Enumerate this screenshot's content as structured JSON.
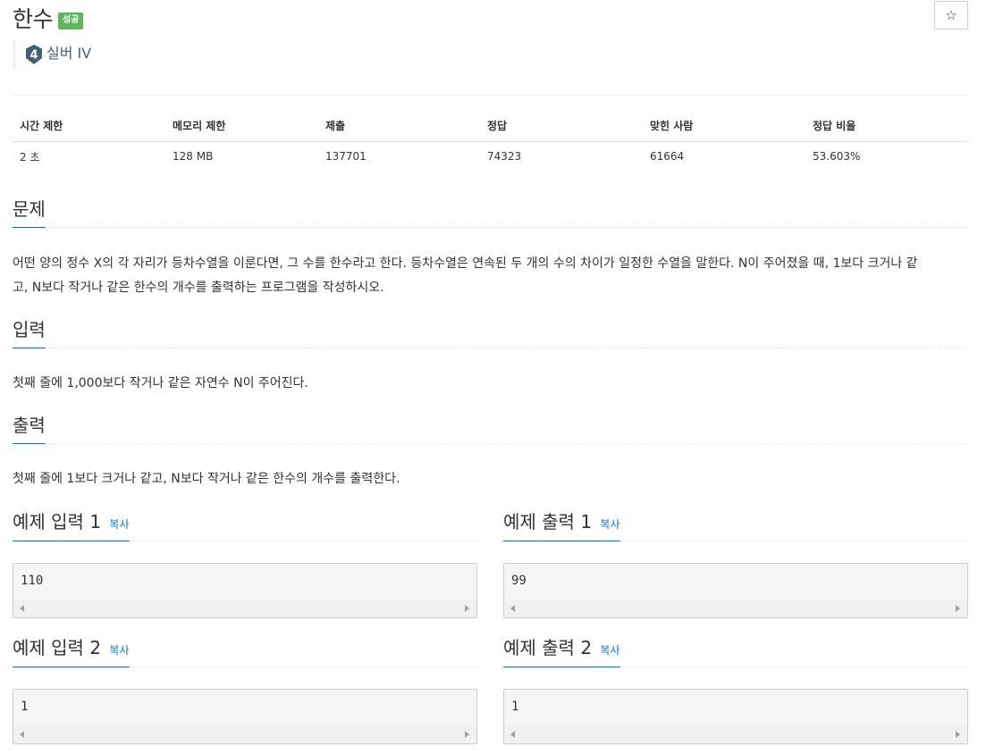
{
  "problem": {
    "title": "한수",
    "status_badge": "성공",
    "star_label": "☆",
    "tier_number": "4",
    "tier": "실버 IV"
  },
  "info_table": {
    "headers": [
      "시간 제한",
      "메모리 제한",
      "제출",
      "정답",
      "맞힌 사람",
      "정답 비율"
    ],
    "values": [
      "2 초",
      "128 MB",
      "137701",
      "74323",
      "61664",
      "53.603%"
    ]
  },
  "sections": {
    "description": {
      "heading": "문제",
      "line1": "어떤 양의 정수 X의 각 자리가 등차수열을 이룬다면, 그 수를 한수라고 한다. 등차수열은 연속된 두 개의 수의 차이가 일정한 수열을 말한다. N이 주어졌을 때, 1보다 크거나 같",
      "line2": "고, N보다 작거나 같은 한수의 개수를 출력하는 프로그램을 작성하시오."
    },
    "input": {
      "heading": "입력",
      "text": "첫째 줄에 1,000보다 작거나 같은 자연수 N이 주어진다."
    },
    "output": {
      "heading": "출력",
      "text": "첫째 줄에 1보다 크거나 같고, N보다 작거나 같은 한수의 개수를 출력한다."
    }
  },
  "examples": [
    {
      "heading": "예제 입력 1",
      "copy": "복사",
      "value": "110"
    },
    {
      "heading": "예제 출력 1",
      "copy": "복사",
      "value": "99"
    },
    {
      "heading": "예제 입력 2",
      "copy": "복사",
      "value": "1"
    },
    {
      "heading": "예제 출력 2",
      "copy": "복사",
      "value": "1"
    }
  ],
  "colors": {
    "success": "#5cb85c",
    "accent": "#0076c0",
    "tier": "#435f7a"
  }
}
